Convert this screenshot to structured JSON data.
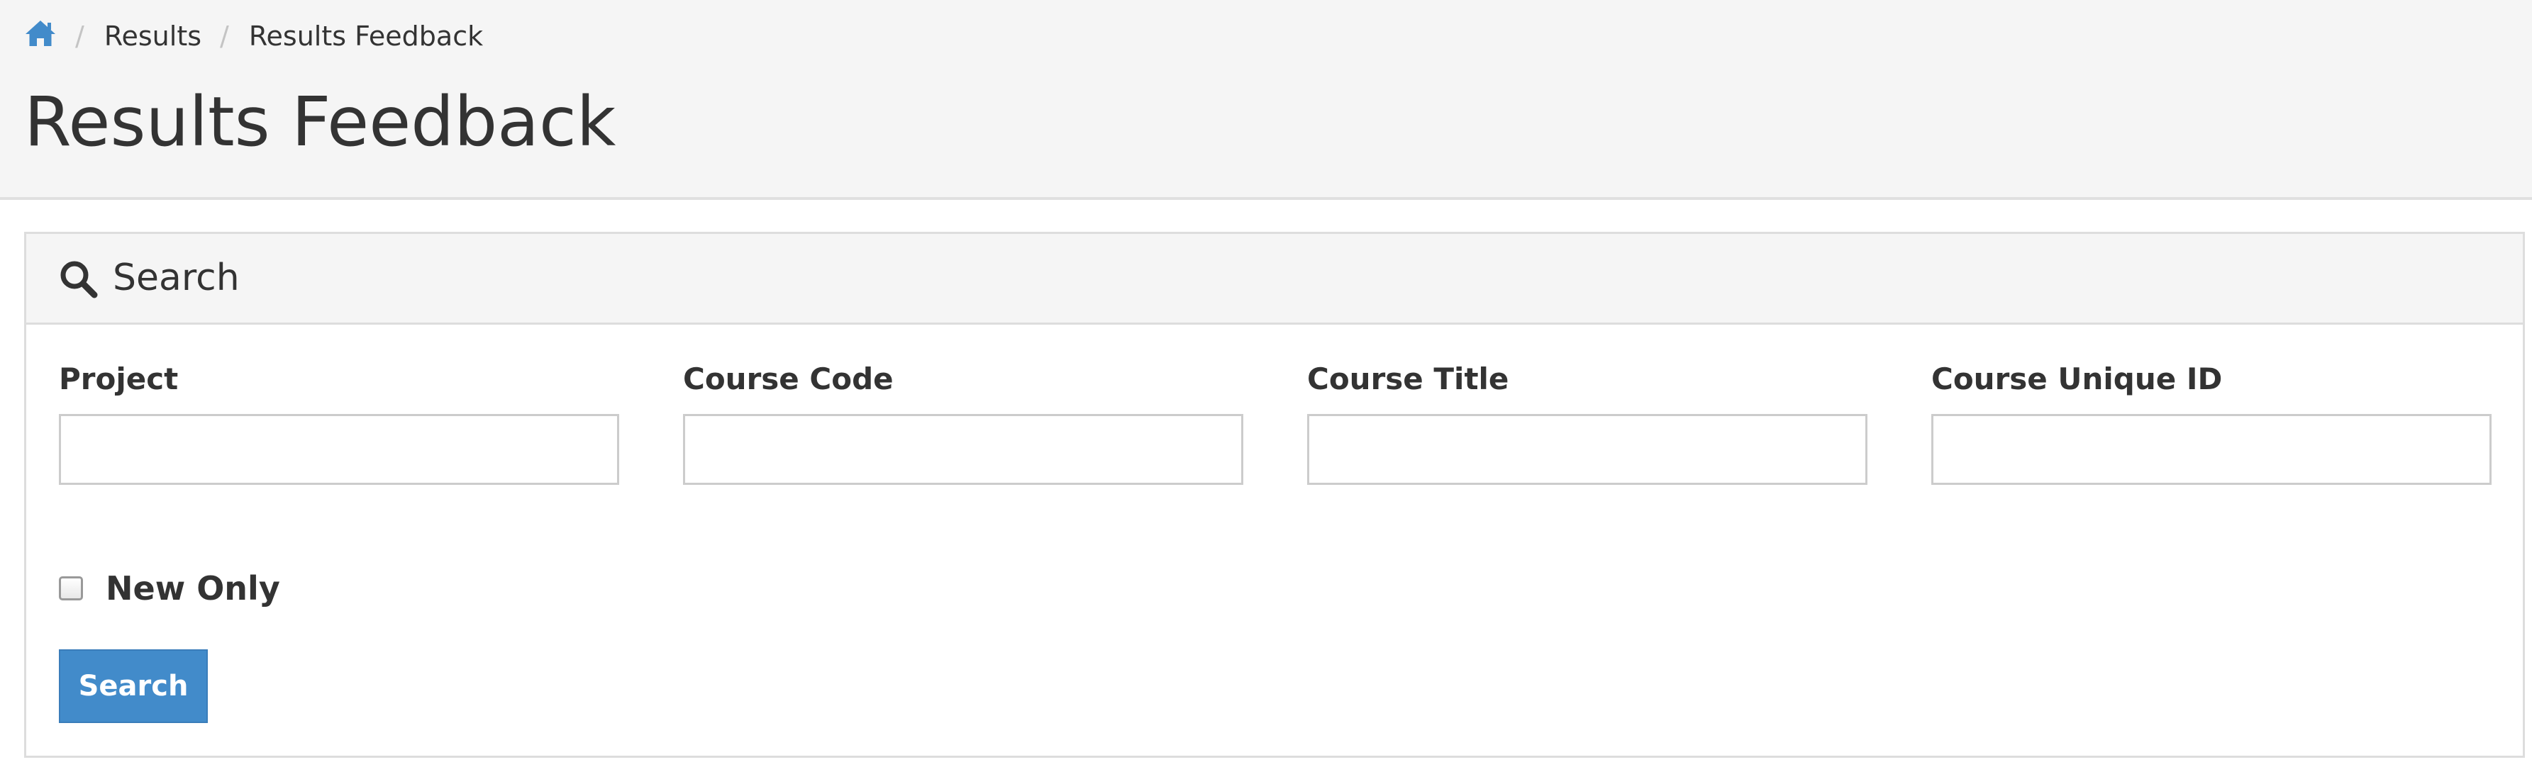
{
  "theme": {
    "accent": "#428bca",
    "header_background": "#f5f5f5",
    "border": "#dddddd",
    "text": "#333333"
  },
  "breadcrumb": {
    "home_icon": "home-icon",
    "items": [
      {
        "label": "Results"
      },
      {
        "label": "Results Feedback"
      }
    ],
    "separator": "/"
  },
  "page": {
    "title": "Results Feedback"
  },
  "search_panel": {
    "icon": "search-icon",
    "title": "Search",
    "fields": [
      {
        "label": "Project",
        "value": "",
        "placeholder": ""
      },
      {
        "label": "Course Code",
        "value": "",
        "placeholder": ""
      },
      {
        "label": "Course Title",
        "value": "",
        "placeholder": ""
      },
      {
        "label": "Course Unique ID",
        "value": "",
        "placeholder": ""
      }
    ],
    "new_only": {
      "label": "New Only",
      "checked": false
    },
    "submit_label": "Search"
  }
}
